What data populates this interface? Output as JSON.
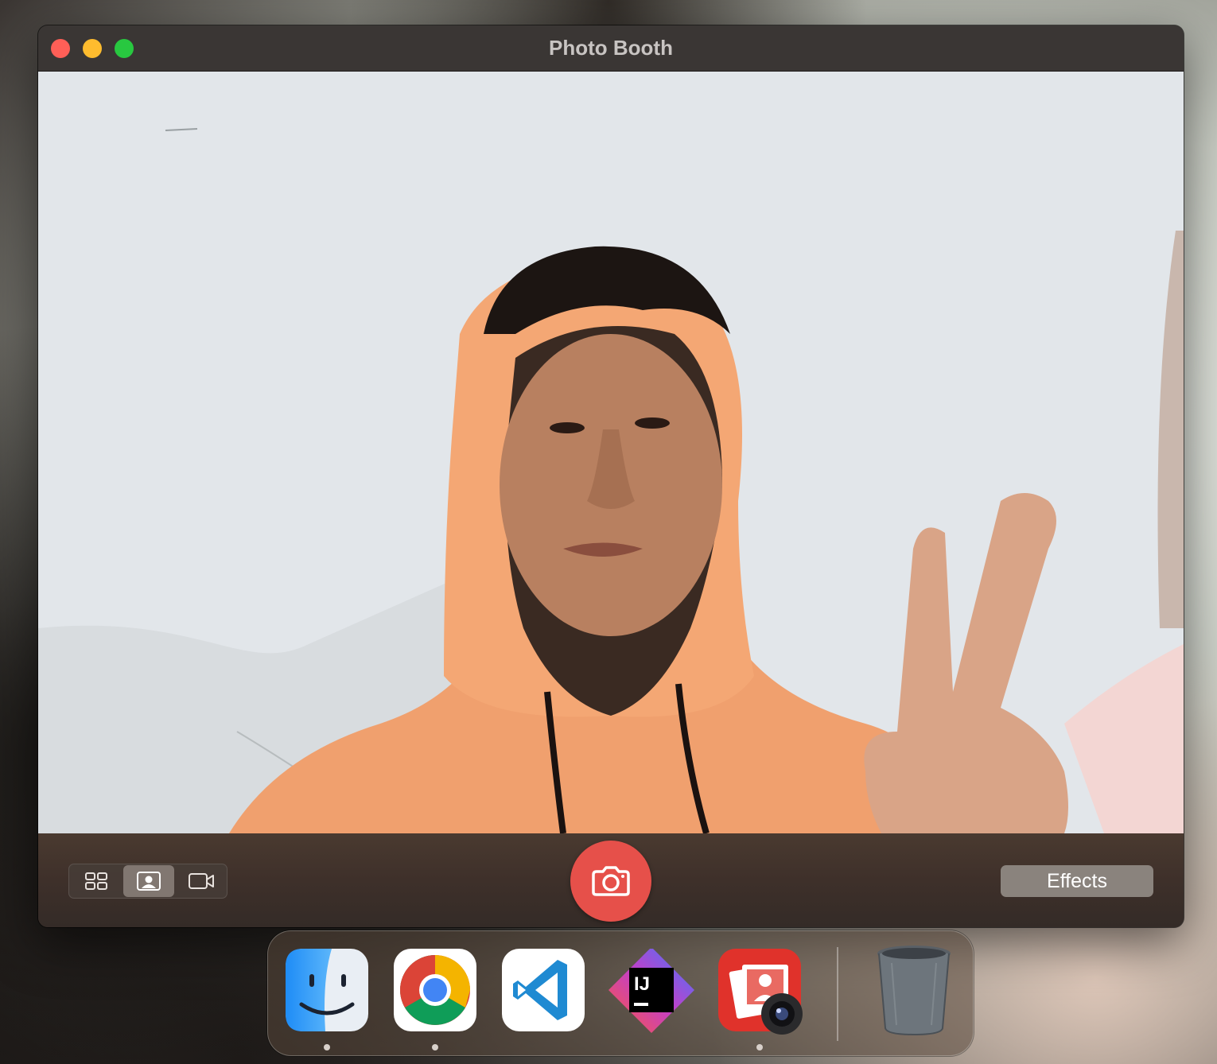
{
  "window": {
    "title": "Photo Booth",
    "traffic_lights": [
      "close",
      "minimize",
      "zoom"
    ]
  },
  "camera": {
    "description_icon": "live-camera-preview"
  },
  "controls": {
    "modes": [
      {
        "name": "grid-4-up-icon",
        "selected": false
      },
      {
        "name": "single-photo-icon",
        "selected": true
      },
      {
        "name": "video-icon",
        "selected": false
      }
    ],
    "shutter_icon": "camera-icon",
    "effects_label": "Effects"
  },
  "dock": {
    "apps": [
      {
        "icon": "finder-icon",
        "running": true
      },
      {
        "icon": "chrome-icon",
        "running": true
      },
      {
        "icon": "vscode-icon",
        "running": false
      },
      {
        "icon": "intellij-icon",
        "running": false
      },
      {
        "icon": "photo-booth-icon",
        "running": true
      },
      {
        "icon": "trash-icon",
        "running": false
      }
    ],
    "intellij_label": "IJ"
  },
  "colors": {
    "shutter": "#e6504a",
    "titlebar": "#3a3634",
    "hoodie": "#f0a06e"
  }
}
